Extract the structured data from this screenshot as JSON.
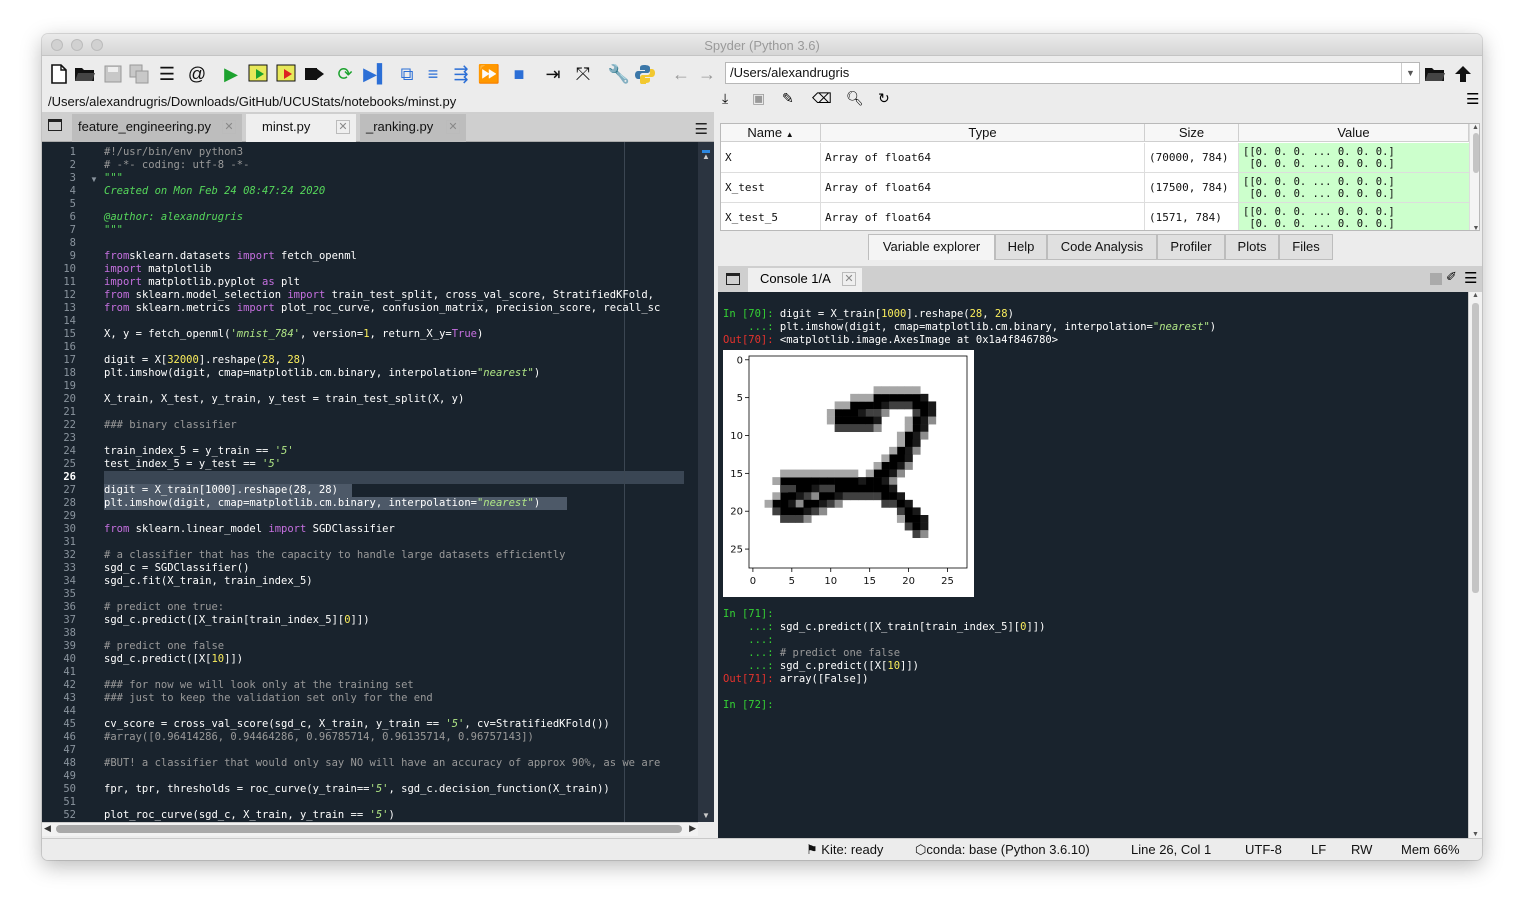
{
  "window": {
    "title": "Spyder (Python 3.6)"
  },
  "toolbar": {
    "path": "/Users/alexandrugris"
  },
  "editor": {
    "file_path": "/Users/alexandrugris/Downloads/GitHub/UCUStats/notebooks/minst.py",
    "tabs": [
      {
        "label": "feature_engineering.py"
      },
      {
        "label": "minst.py"
      },
      {
        "label": "_ranking.py"
      }
    ],
    "current_line": 26,
    "lines": [
      [
        [
          "cm",
          "#!/usr/bin/env python3"
        ]
      ],
      [
        [
          "cm",
          "# -*- coding: utf-8 -*-"
        ]
      ],
      [
        [
          "ds",
          "\"\"\""
        ]
      ],
      [
        [
          "ds",
          "Created on Mon Feb 24 08:47:24 2020"
        ]
      ],
      [],
      [
        [
          "ds",
          "@author: alexandrugris"
        ]
      ],
      [
        [
          "ds",
          "\"\"\""
        ]
      ],
      [],
      [
        [
          "kw",
          "from"
        ],
        [
          "",
          "sklearn.datasets "
        ],
        [
          "kw",
          "import"
        ],
        [
          "",
          " fetch_openml"
        ]
      ],
      [
        [
          "kw",
          "import"
        ],
        [
          "",
          " matplotlib"
        ]
      ],
      [
        [
          "kw",
          "import"
        ],
        [
          "",
          " matplotlib.pyplot "
        ],
        [
          "kw",
          "as"
        ],
        [
          "",
          " plt"
        ]
      ],
      [
        [
          "kw",
          "from"
        ],
        [
          "",
          " sklearn.model_selection "
        ],
        [
          "kw",
          "import"
        ],
        [
          "",
          " train_test_split, cross_val_score, StratifiedKFold,"
        ]
      ],
      [
        [
          "kw",
          "from"
        ],
        [
          "",
          " sklearn.metrics "
        ],
        [
          "kw",
          "import"
        ],
        [
          "",
          " plot_roc_curve, confusion_matrix, precision_score, recall_sc"
        ]
      ],
      [],
      [
        [
          "",
          "X, y = fetch_openml("
        ],
        [
          "st",
          "'mnist_784'"
        ],
        [
          "",
          ", version="
        ],
        [
          "nm",
          "1"
        ],
        [
          "",
          ", return_X_y="
        ],
        [
          "kw",
          "True"
        ],
        [
          "",
          ")"
        ]
      ],
      [],
      [
        [
          "",
          "digit = X["
        ],
        [
          "nm",
          "32000"
        ],
        [
          "",
          "].reshape("
        ],
        [
          "nm",
          "28"
        ],
        [
          "",
          ", "
        ],
        [
          "nm",
          "28"
        ],
        [
          "",
          ")"
        ]
      ],
      [
        [
          "",
          "plt.imshow(digit, cmap=matplotlib.cm.binary, interpolation="
        ],
        [
          "st",
          "\"nearest\""
        ],
        [
          "",
          ")"
        ]
      ],
      [],
      [
        [
          "",
          "X_train, X_test, y_train, y_test = train_test_split(X, y)"
        ]
      ],
      [],
      [
        [
          "cm",
          "### binary classifier"
        ]
      ],
      [],
      [
        [
          "",
          "train_index_5 = y_train == "
        ],
        [
          "st",
          "'5'"
        ]
      ],
      [
        [
          "",
          "test_index_5 = y_test == "
        ],
        [
          "st",
          "'5'"
        ]
      ],
      [],
      [
        [
          "",
          "digit = X_train[1000].reshape(28, 28)"
        ]
      ],
      [
        [
          "",
          "plt.imshow(digit, cmap=matplotlib.cm.binary, interpolation="
        ],
        [
          "st",
          "\"nearest\""
        ],
        [
          "",
          ")"
        ]
      ],
      [],
      [
        [
          "kw",
          "from"
        ],
        [
          "",
          " sklearn.linear_model "
        ],
        [
          "kw",
          "import"
        ],
        [
          "",
          " SGDClassifier"
        ]
      ],
      [],
      [
        [
          "cm",
          "# a classifier that has the capacity to handle large datasets efficiently"
        ]
      ],
      [
        [
          "",
          "sgd_c = SGDClassifier()"
        ]
      ],
      [
        [
          "",
          "sgd_c.fit(X_train, train_index_5)"
        ]
      ],
      [],
      [
        [
          "cm",
          "# predict one true:"
        ]
      ],
      [
        [
          "",
          "sgd_c.predict([X_train[train_index_5]["
        ],
        [
          "nm",
          "0"
        ],
        [
          "",
          "]])"
        ]
      ],
      [],
      [
        [
          "cm",
          "# predict one false"
        ]
      ],
      [
        [
          "",
          "sgd_c.predict([X["
        ],
        [
          "nm",
          "10"
        ],
        [
          "",
          "]])"
        ]
      ],
      [],
      [
        [
          "cm",
          "### for now we will look only at the training set"
        ]
      ],
      [
        [
          "cm",
          "### just to keep the validation set only for the end"
        ]
      ],
      [],
      [
        [
          "",
          "cv_score = cross_val_score(sgd_c, X_train, y_train == "
        ],
        [
          "st",
          "'5'"
        ],
        [
          "",
          ", cv=StratifiedKFold())"
        ]
      ],
      [
        [
          "cm",
          "#array([0.96414286, 0.94464286, 0.96785714, 0.96135714, 0.96757143])"
        ]
      ],
      [],
      [
        [
          "cm",
          "#BUT! a classifier that would only say NO will have an accuracy of approx 90%, as we are"
        ]
      ],
      [],
      [
        [
          "",
          "fpr, tpr, thresholds = roc_curve(y_train=="
        ],
        [
          "st",
          "'5'"
        ],
        [
          "",
          ", sgd_c.decision_function(X_train))"
        ]
      ],
      [],
      [
        [
          "",
          "plot_roc_curve(sgd_c, X_train, y_train == "
        ],
        [
          "st",
          "'5'"
        ],
        [
          "",
          ")"
        ]
      ]
    ]
  },
  "variable_explorer": {
    "columns": [
      "Name",
      "Type",
      "Size",
      "Value"
    ],
    "rows": [
      {
        "name": "X",
        "type": "Array of float64",
        "size": "(70000, 784)",
        "value": "[[0. 0. 0. ... 0. 0. 0.]\n [0. 0. 0. ... 0. 0. 0.]"
      },
      {
        "name": "X_test",
        "type": "Array of float64",
        "size": "(17500, 784)",
        "value": "[[0. 0. 0. ... 0. 0. 0.]\n [0. 0. 0. ... 0. 0. 0.]"
      },
      {
        "name": "X_test_5",
        "type": "Array of float64",
        "size": "(1571, 784)",
        "value": "[[0. 0. 0. ... 0. 0. 0.]\n [0. 0. 0. ... 0. 0. 0.]"
      }
    ]
  },
  "pane_tabs": [
    "Variable explorer",
    "Help",
    "Code Analysis",
    "Profiler",
    "Plots",
    "Files"
  ],
  "console": {
    "tab": "Console 1/A",
    "lines": [
      [
        [
          "in",
          "In ["
        ],
        [
          "in",
          "70"
        ],
        [
          "in",
          "]: "
        ],
        [
          "",
          "digit = X_train["
        ],
        [
          "nm",
          "1000"
        ],
        [
          "",
          "].reshape("
        ],
        [
          "nm",
          "28"
        ],
        [
          "",
          ", "
        ],
        [
          "nm",
          "28"
        ],
        [
          "",
          ")"
        ]
      ],
      [
        [
          "in",
          "    ...: "
        ],
        [
          "",
          "plt.imshow(digit, cmap=matplotlib.cm.binary, interpolation="
        ],
        [
          "st",
          "\"nearest\""
        ],
        [
          "",
          ")"
        ]
      ],
      [
        [
          "out",
          "Out[70]: "
        ],
        [
          "",
          "<matplotlib.image.AxesImage at 0x1a4f846780>"
        ]
      ],
      [
        [
          "in",
          "In [71]:"
        ]
      ],
      [
        [
          "in",
          "    ...: "
        ],
        [
          "",
          "sgd_c.predict([X_train[train_index_5]["
        ],
        [
          "nm",
          "0"
        ],
        [
          "",
          "]])"
        ]
      ],
      [
        [
          "in",
          "    ...:"
        ]
      ],
      [
        [
          "in",
          "    ...: "
        ],
        [
          "cm",
          "# predict one false"
        ]
      ],
      [
        [
          "in",
          "    ...: "
        ],
        [
          "",
          "sgd_c.predict([X["
        ],
        [
          "nm",
          "10"
        ],
        [
          "",
          "]])"
        ]
      ],
      [
        [
          "out",
          "Out[71]: "
        ],
        [
          "",
          "array([False])"
        ]
      ],
      [
        [
          "in",
          "In [72]:"
        ]
      ]
    ],
    "plot": {
      "x_ticks": [
        "0",
        "5",
        "10",
        "15",
        "20",
        "25"
      ],
      "y_ticks": [
        "0",
        "5",
        "10",
        "15",
        "20",
        "25"
      ]
    }
  },
  "status": {
    "kite": "Kite: ready",
    "conda": "conda: base (Python 3.6.10)",
    "position": "Line 26, Col 1",
    "encoding": "UTF-8",
    "eol": "LF",
    "perm": "RW",
    "mem": "Mem 66%"
  }
}
